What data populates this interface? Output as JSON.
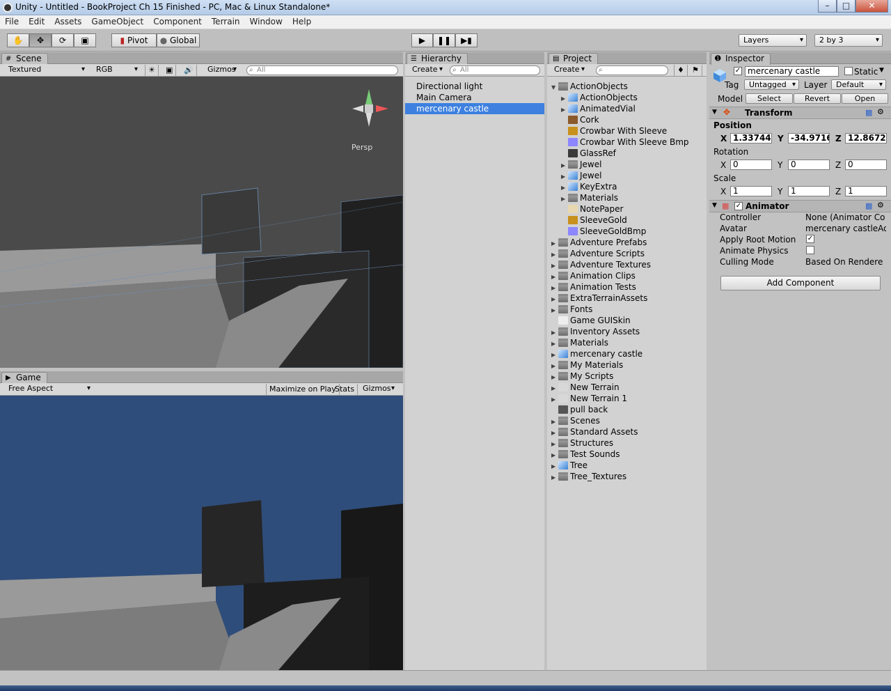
{
  "window": {
    "title": "Unity - Untitled - BookProject Ch 15 Finished - PC, Mac & Linux Standalone*",
    "min": "–",
    "max": "□",
    "close": "✕"
  },
  "menu": [
    "File",
    "Edit",
    "Assets",
    "GameObject",
    "Component",
    "Terrain",
    "Window",
    "Help"
  ],
  "toolbar": {
    "pivot": "Pivot",
    "global": "Global",
    "layers": "Layers",
    "layout": "2 by 3"
  },
  "scene": {
    "tab": "Scene",
    "shading": "Textured",
    "render": "RGB",
    "gizmos": "Gizmos",
    "search_placeholder": "All",
    "persp": "Persp",
    "sky": "#4a4a4a"
  },
  "game": {
    "tab": "Game",
    "aspect": "Free Aspect",
    "maximize": "Maximize on Play",
    "stats": "Stats",
    "gizmos": "Gizmos",
    "sky": "#2f4d7a"
  },
  "hierarchy": {
    "tab": "Hierarchy",
    "create": "Create",
    "search_placeholder": "All",
    "items": [
      "Directional light",
      "Main Camera",
      "mercenary castle"
    ],
    "selected": 2
  },
  "project": {
    "tab": "Project",
    "create": "Create",
    "items": [
      {
        "label": "ActionObjects",
        "icon": "folder",
        "depth": 0,
        "arrow": "▼"
      },
      {
        "label": "ActionObjects",
        "icon": "cube",
        "depth": 1,
        "arrow": "▶"
      },
      {
        "label": "AnimatedVial",
        "icon": "cube",
        "depth": 1,
        "arrow": "▶"
      },
      {
        "label": "Cork",
        "icon": "tex-brown",
        "depth": 1,
        "arrow": ""
      },
      {
        "label": "Crowbar With Sleeve",
        "icon": "tex-gold",
        "depth": 1,
        "arrow": ""
      },
      {
        "label": "Crowbar With Sleeve Bmp",
        "icon": "tex-blue",
        "depth": 1,
        "arrow": ""
      },
      {
        "label": "GlassRef",
        "icon": "tex-dark",
        "depth": 1,
        "arrow": ""
      },
      {
        "label": "Jewel",
        "icon": "folder",
        "depth": 1,
        "arrow": "▶"
      },
      {
        "label": "Jewel",
        "icon": "cube",
        "depth": 1,
        "arrow": "▶"
      },
      {
        "label": "KeyExtra",
        "icon": "cube",
        "depth": 1,
        "arrow": "▶"
      },
      {
        "label": "Materials",
        "icon": "folder",
        "depth": 1,
        "arrow": "▶"
      },
      {
        "label": "NotePaper",
        "icon": "tex-paper",
        "depth": 1,
        "arrow": ""
      },
      {
        "label": "SleeveGold",
        "icon": "tex-gold",
        "depth": 1,
        "arrow": ""
      },
      {
        "label": "SleeveGoldBmp",
        "icon": "tex-blue",
        "depth": 1,
        "arrow": ""
      },
      {
        "label": "Adventure Prefabs",
        "icon": "folder",
        "depth": 0,
        "arrow": "▶"
      },
      {
        "label": "Adventure Scripts",
        "icon": "folder",
        "depth": 0,
        "arrow": "▶"
      },
      {
        "label": "Adventure Textures",
        "icon": "folder",
        "depth": 0,
        "arrow": "▶"
      },
      {
        "label": "Animation Clips",
        "icon": "folder",
        "depth": 0,
        "arrow": "▶"
      },
      {
        "label": "Animation Tests",
        "icon": "folder",
        "depth": 0,
        "arrow": "▶"
      },
      {
        "label": "ExtraTerrainAssets",
        "icon": "folder",
        "depth": 0,
        "arrow": "▶"
      },
      {
        "label": "Fonts",
        "icon": "folder",
        "depth": 0,
        "arrow": "▶"
      },
      {
        "label": "Game GUISkin",
        "icon": "doc",
        "depth": 0,
        "arrow": ""
      },
      {
        "label": "Inventory Assets",
        "icon": "folder",
        "depth": 0,
        "arrow": "▶"
      },
      {
        "label": "Materials",
        "icon": "folder",
        "depth": 0,
        "arrow": "▶"
      },
      {
        "label": "mercenary castle",
        "icon": "cube",
        "depth": 0,
        "arrow": "▶"
      },
      {
        "label": "My Materials",
        "icon": "folder",
        "depth": 0,
        "arrow": "▶"
      },
      {
        "label": "My Scripts",
        "icon": "folder",
        "depth": 0,
        "arrow": "▶"
      },
      {
        "label": "New Terrain",
        "icon": "terrain",
        "depth": 0,
        "arrow": "▶"
      },
      {
        "label": "New Terrain 1",
        "icon": "terrain",
        "depth": 0,
        "arrow": "▶"
      },
      {
        "label": "pull back",
        "icon": "anim",
        "depth": 0,
        "arrow": ""
      },
      {
        "label": "Scenes",
        "icon": "folder",
        "depth": 0,
        "arrow": "▶"
      },
      {
        "label": "Standard Assets",
        "icon": "folder",
        "depth": 0,
        "arrow": "▶"
      },
      {
        "label": "Structures",
        "icon": "folder",
        "depth": 0,
        "arrow": "▶"
      },
      {
        "label": "Test Sounds",
        "icon": "folder",
        "depth": 0,
        "arrow": "▶"
      },
      {
        "label": "Tree",
        "icon": "cube",
        "depth": 0,
        "arrow": "▶"
      },
      {
        "label": "Tree_Textures",
        "icon": "folder",
        "depth": 0,
        "arrow": "▶"
      }
    ]
  },
  "inspector": {
    "tab": "Inspector",
    "name": "mercenary castle",
    "static": "Static",
    "tag_label": "Tag",
    "tag": "Untagged",
    "layer_label": "Layer",
    "layer": "Default",
    "model_label": "Model",
    "select": "Select",
    "revert": "Revert",
    "open": "Open",
    "transform": {
      "title": "Transform",
      "position": "Position",
      "rotation": "Rotation",
      "scale": "Scale",
      "pos": [
        "1.33744",
        "-34.9716",
        "12.8672"
      ],
      "rot": [
        "0",
        "0",
        "0"
      ],
      "scl": [
        "1",
        "1",
        "1"
      ],
      "x": "X",
      "y": "Y",
      "z": "Z"
    },
    "animator": {
      "title": "Animator",
      "controller_label": "Controller",
      "controller": "None (Animator Co",
      "avatar_label": "Avatar",
      "avatar": "mercenary castleAo",
      "root_motion": "Apply Root Motion",
      "physics": "Animate Physics",
      "culling_label": "Culling Mode",
      "culling": "Based On Rendere"
    },
    "add_component": "Add Component"
  }
}
